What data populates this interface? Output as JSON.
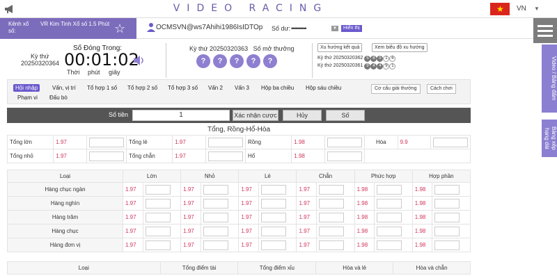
{
  "header": {
    "title": "VIDEO RACING",
    "language": "VN"
  },
  "lottery": {
    "channel_label": "Kênh xổ số:",
    "name": "VR Kim Tinh Xổ số 1.5 Phút"
  },
  "account": {
    "username": "OCMSVN@ws7Ahihi1986IsIDTOp",
    "balance_label": "Số dư:",
    "balance_value": "••••••••••",
    "show_label": "Hiển thị"
  },
  "side_tabs": {
    "video": "Video / Bảng đấm",
    "ranking": "Bảng xếp hạng dài"
  },
  "timer": {
    "label": "Số Đóng Trong:",
    "draw_label": "Kỳ thứ",
    "draw_id": "20250320364",
    "countdown": "00:01:02",
    "unit_hour": "Thời",
    "unit_min": "phút",
    "unit_sec": "giây"
  },
  "open": {
    "label": "Kỳ thứ 20250320363",
    "result_label": "Số mở thưởng",
    "balls": [
      "?",
      "?",
      "?",
      "?",
      "?"
    ]
  },
  "trend": {
    "result_btn": "Xu hướng kết quả",
    "chart_btn": "Xem biểu đồ xu hướng",
    "history": [
      {
        "label": "Kỳ thứ 20250320362",
        "balls": [
          "5",
          "8",
          "5",
          "1",
          "6"
        ]
      },
      {
        "label": "Kỳ thứ 20250320361",
        "balls": [
          "9",
          "4",
          "4",
          "9",
          "1"
        ]
      }
    ]
  },
  "tabs": {
    "row1": [
      "Hội nhập",
      "Vấn, vị trí",
      "Tổ hợp 1 số",
      "Tổ hợp 2 số",
      "Tổ hợp 3 số",
      "Vấn 2",
      "Vấn 3",
      "Hộp ba chiều",
      "Hộp sáu chiều"
    ],
    "row2": [
      "Phạm vi",
      "Đấu bò"
    ],
    "prize_btn": "Cơ cấu giải thưởng",
    "howto_btn": "Cách chơi"
  },
  "bet": {
    "amount_label": "Số tiền",
    "amount_value": "1",
    "confirm": "Xác nhận cược",
    "cancel": "Hủy",
    "numbers": "Số"
  },
  "section1": {
    "title": "Tổng, Rồng-Hổ-Hòa",
    "rows": [
      [
        {
          "label": "Tổng lớn",
          "odds": "1.97"
        },
        {
          "label": "Tổng lẻ",
          "odds": "1.97"
        },
        {
          "label": "Rồng",
          "odds": "1.98"
        },
        {
          "label": "Hòa",
          "odds": "9.9"
        }
      ],
      [
        {
          "label": "Tổng nhỏ",
          "odds": "1.97"
        },
        {
          "label": "Tổng chẵn",
          "odds": "1.97"
        },
        {
          "label": "Hổ",
          "odds": "1.98"
        }
      ]
    ]
  },
  "section2": {
    "headers": [
      "Loại",
      "Lớn",
      "Nhỏ",
      "Lẻ",
      "Chẵn",
      "Phức hợp",
      "Hợp phần"
    ],
    "rows": [
      {
        "label": "Hàng chục ngàn",
        "odds": [
          "1.97",
          "1.97",
          "1.97",
          "1.97",
          "1.98",
          "1.98"
        ]
      },
      {
        "label": "Hàng nghìn",
        "odds": [
          "1.97",
          "1.97",
          "1.97",
          "1.97",
          "1.98",
          "1.98"
        ]
      },
      {
        "label": "Hàng trăm",
        "odds": [
          "1.97",
          "1.97",
          "1.97",
          "1.97",
          "1.98",
          "1.98"
        ]
      },
      {
        "label": "Hàng chục",
        "odds": [
          "1.97",
          "1.97",
          "1.97",
          "1.97",
          "1.98",
          "1.98"
        ]
      },
      {
        "label": "Hàng đơn vị",
        "odds": [
          "1.97",
          "1.97",
          "1.97",
          "1.97",
          "1.98",
          "1.98"
        ]
      }
    ]
  },
  "section3": {
    "headers": [
      "Loại",
      "Tổng điểm tài",
      "Tổng điểm xỉu",
      "Hòa và lẻ",
      "Hòa và chẵn"
    ]
  }
}
